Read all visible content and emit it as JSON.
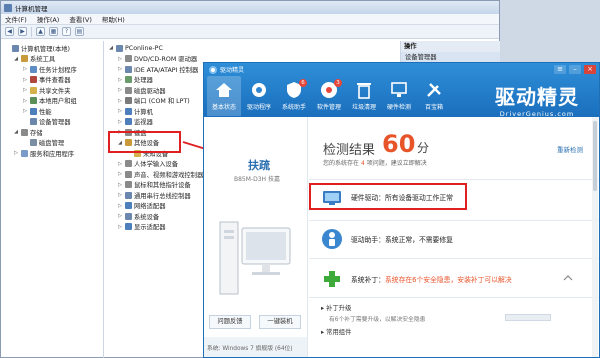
{
  "computer_management": {
    "title": "计算机管理",
    "menu": [
      "文件(F)",
      "操作(A)",
      "查看(V)",
      "帮助(H)"
    ],
    "tree": [
      {
        "label": "计算机管理(本地)",
        "indent": 0,
        "toggle": "",
        "color": "#6b87ad"
      },
      {
        "label": "系统工具",
        "indent": 1,
        "toggle": "◢",
        "color": "#c99a3a"
      },
      {
        "label": "任务计划程序",
        "indent": 2,
        "toggle": "▷",
        "color": "#5d8dc4"
      },
      {
        "label": "事件查看器",
        "indent": 2,
        "toggle": "▷",
        "color": "#b0473e"
      },
      {
        "label": "共享文件夹",
        "indent": 2,
        "toggle": "▷",
        "color": "#d4b14b"
      },
      {
        "label": "本地用户和组",
        "indent": 2,
        "toggle": "▷",
        "color": "#5a8f5a"
      },
      {
        "label": "性能",
        "indent": 2,
        "toggle": "▷",
        "color": "#4d7fbd"
      },
      {
        "label": "设备管理器",
        "indent": 2,
        "toggle": "",
        "color": "#6b87ad"
      },
      {
        "label": "存储",
        "indent": 1,
        "toggle": "◢",
        "color": "#8a8a8a"
      },
      {
        "label": "磁盘管理",
        "indent": 2,
        "toggle": "",
        "color": "#7b8da3"
      },
      {
        "label": "服务和应用程序",
        "indent": 1,
        "toggle": "▷",
        "color": "#7a9bc7"
      }
    ],
    "devices": [
      {
        "label": "PConline-PC",
        "indent": 0,
        "toggle": "◢",
        "color": "#6b87ad"
      },
      {
        "label": "DVD/CD-ROM 驱动器",
        "indent": 1,
        "toggle": "▷",
        "color": "#8a8a8a"
      },
      {
        "label": "IDE ATA/ATAPI 控制器",
        "indent": 1,
        "toggle": "▷",
        "color": "#6b87ad"
      },
      {
        "label": "处理器",
        "indent": 1,
        "toggle": "▷",
        "color": "#6a9b6a"
      },
      {
        "label": "磁盘驱动器",
        "indent": 1,
        "toggle": "▷",
        "color": "#8a8a8a"
      },
      {
        "label": "端口 (COM 和 LPT)",
        "indent": 1,
        "toggle": "▷",
        "color": "#7a7a7a"
      },
      {
        "label": "计算机",
        "indent": 1,
        "toggle": "▷",
        "color": "#4d7fbd"
      },
      {
        "label": "监视器",
        "indent": 1,
        "toggle": "▷",
        "color": "#4d7fbd"
      },
      {
        "label": "键盘",
        "indent": 1,
        "toggle": "▷",
        "color": "#8a8a8a"
      },
      {
        "label": "其他设备",
        "indent": 1,
        "toggle": "◢",
        "color": "#c99a3a"
      },
      {
        "label": "未知设备",
        "indent": 2,
        "toggle": "",
        "color": "#d4b14b"
      },
      {
        "label": "人体学输入设备",
        "indent": 1,
        "toggle": "▷",
        "color": "#8a8a8a"
      },
      {
        "label": "声音、视频和游戏控制器",
        "indent": 1,
        "toggle": "▷",
        "color": "#8a8a8a"
      },
      {
        "label": "鼠标和其他指针设备",
        "indent": 1,
        "toggle": "▷",
        "color": "#8a8a8a"
      },
      {
        "label": "通用串行总线控制器",
        "indent": 1,
        "toggle": "▷",
        "color": "#6b87ad"
      },
      {
        "label": "网络适配器",
        "indent": 1,
        "toggle": "▷",
        "color": "#4d7fbd"
      },
      {
        "label": "系统设备",
        "indent": 1,
        "toggle": "▷",
        "color": "#6b87ad"
      },
      {
        "label": "显示适配器",
        "indent": 1,
        "toggle": "▷",
        "color": "#4d7fbd"
      }
    ],
    "operations": {
      "heading": "操作",
      "item": "设备管理器"
    }
  },
  "driver_genius": {
    "window_title": "驱动精灵",
    "nav": [
      {
        "label": "基本状态",
        "icon": "home-icon",
        "active": true
      },
      {
        "label": "驱动程序",
        "icon": "gear-icon",
        "active": false
      },
      {
        "label": "系统助手",
        "icon": "shield-icon",
        "active": false,
        "badge": "6"
      },
      {
        "label": "软件管理",
        "icon": "software-icon",
        "active": false,
        "badge": "3"
      },
      {
        "label": "垃圾清理",
        "icon": "trash-icon",
        "active": false
      },
      {
        "label": "硬件检测",
        "icon": "monitor-icon",
        "active": false
      },
      {
        "label": "百宝箱",
        "icon": "tools-icon",
        "active": false
      }
    ],
    "logo": {
      "main": "驱动精灵",
      "sub": "DriverGenius.com"
    },
    "pc": {
      "name": "扶疏",
      "model": "B85M-D3H 技嘉",
      "btn_feedback": "问题反馈",
      "btn_install": "一键装机",
      "os": "系统: Windows 7 旗舰版 (64位)"
    },
    "result": {
      "label": "检测结果",
      "score": "60",
      "unit": "分",
      "sub_prefix": "您的系统存在",
      "count": "4",
      "sub_suffix": "项问题，建议立即解决",
      "recheck": "重新检测"
    },
    "hardware": {
      "title": "硬件驱动：",
      "status": "所有设备驱动工作正常"
    },
    "helper": {
      "title": "驱动助手：",
      "status": "系统正常，不需要修复"
    },
    "patch": {
      "title": "系统补丁：",
      "status": "系统存在6个安全隐患，安装补丁可以解决"
    },
    "patch_items": [
      {
        "name": "补丁升级",
        "desc": "有6个补丁需要升级，以解决安全隐患",
        "progress": 0.0
      },
      {
        "name": "常用组件",
        "desc": "",
        "progress": null
      }
    ]
  },
  "colors": {
    "accent_blue": "#1a6fbd",
    "highlight_red": "#e02020",
    "score_orange": "#e8542a"
  }
}
